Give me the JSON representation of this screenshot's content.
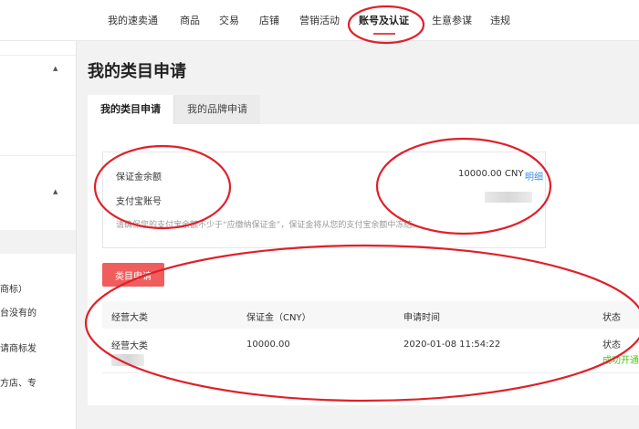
{
  "nav": {
    "items": [
      {
        "label": "我的速卖通"
      },
      {
        "label": "商品"
      },
      {
        "label": "交易"
      },
      {
        "label": "店铺"
      },
      {
        "label": "营销活动"
      },
      {
        "label": "账号及认证"
      },
      {
        "label": "生意参谋"
      },
      {
        "label": "违规"
      }
    ],
    "active_index": 5
  },
  "sidebar": {
    "texts": [
      "商标）",
      "台没有的",
      "请商标发",
      "方店、专"
    ]
  },
  "page_title": "我的类目申请",
  "tabs": [
    {
      "label": "我的类目申请"
    },
    {
      "label": "我的品牌申请"
    }
  ],
  "deposit": {
    "balance_label": "保证金余额",
    "account_label": "支付宝账号",
    "amount": "10000.00 CNY",
    "detail_link": "明细",
    "hint": "请确保您的支付宝余额不少于“应缴纳保证金”，保证金将从您的支付宝余额中冻结。"
  },
  "apply_button": "类目申请",
  "table": {
    "headers": [
      "经营大类",
      "保证金（CNY）",
      "申请时间",
      "状态"
    ],
    "rows": [
      {
        "category": "经营大类",
        "deposit": "10000.00",
        "time": "2020-01-08 11:54:22",
        "status": "状态",
        "status_result": "成功开通"
      }
    ]
  },
  "colors": {
    "accent": "#e5484d",
    "button": "#f05d5d",
    "link": "#3a8ee6",
    "success": "#52c41a",
    "annotation": "#e0202a"
  }
}
